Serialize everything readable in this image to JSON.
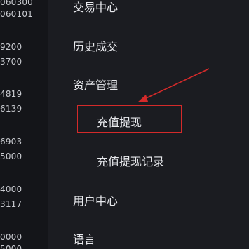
{
  "ticker": {
    "rows": [
      "060300",
      "060101",
      "9200",
      "3700",
      "4819",
      "6139",
      "6903",
      "5000",
      "4000",
      "3117",
      "0000",
      "5000"
    ]
  },
  "menu": {
    "items": [
      {
        "label": "交易中心"
      },
      {
        "label": "历史成交"
      },
      {
        "label": "资产管理"
      },
      {
        "label": "用户中心"
      },
      {
        "label": "语言"
      }
    ],
    "submenu": [
      {
        "label": "充值提现"
      },
      {
        "label": "充值提现记录"
      }
    ]
  },
  "annotation": {
    "highlight_color": "#d42a2a",
    "arrow_color": "#d42a2a"
  }
}
